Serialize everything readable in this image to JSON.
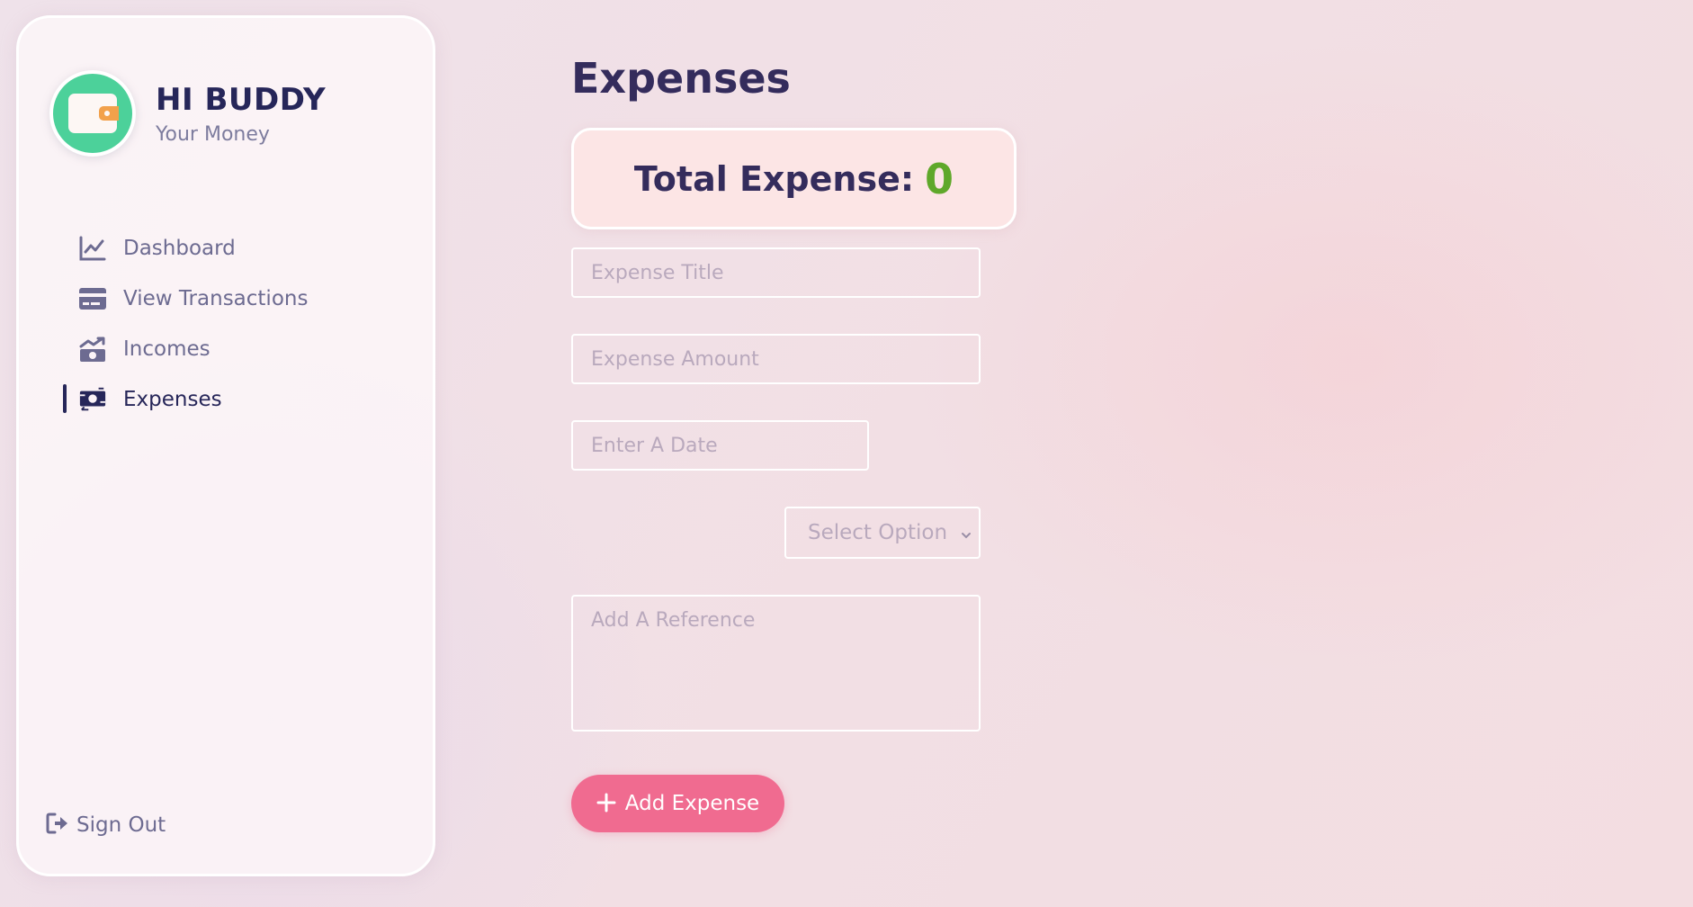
{
  "profile": {
    "name": "HI BUDDY",
    "subtitle": "Your Money"
  },
  "nav": {
    "items": [
      {
        "label": "Dashboard",
        "icon": "line-chart-icon"
      },
      {
        "label": "View Transactions",
        "icon": "credit-card-icon"
      },
      {
        "label": "Incomes",
        "icon": "money-trend-icon"
      },
      {
        "label": "Expenses",
        "icon": "money-exchange-icon",
        "active": true
      }
    ],
    "signout_label": "Sign Out"
  },
  "page": {
    "title": "Expenses",
    "total_label": "Total Expense:",
    "total_value": "0"
  },
  "form": {
    "title_placeholder": "Expense Title",
    "amount_placeholder": "Expense Amount",
    "date_placeholder": "Enter A Date",
    "select_value": "Select Option",
    "reference_placeholder": "Add A Reference",
    "submit_label": "Add Expense"
  },
  "colors": {
    "accent": "#f06b90",
    "total_value": "#5fa82a",
    "avatar": "#4cd19a",
    "heading": "#342c5c"
  }
}
